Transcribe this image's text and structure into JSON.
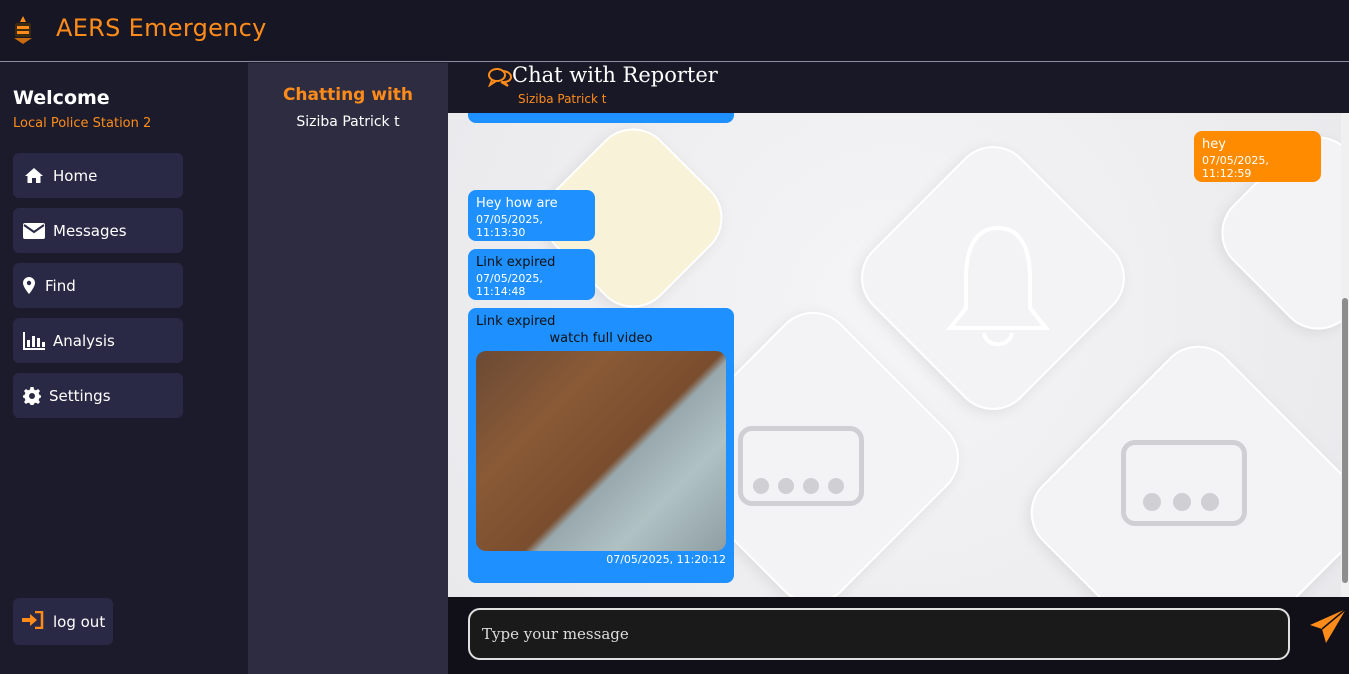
{
  "app": {
    "title": "AERS Emergency"
  },
  "sidebar": {
    "welcome": "Welcome",
    "station": "Local Police Station 2",
    "items": [
      {
        "label": "Home",
        "icon": "home-icon"
      },
      {
        "label": "Messages",
        "icon": "envelope-icon"
      },
      {
        "label": "Find",
        "icon": "map-pin-icon"
      },
      {
        "label": "Analysis",
        "icon": "bar-chart-icon"
      },
      {
        "label": "Settings",
        "icon": "gear-icon"
      }
    ],
    "logout": "log out"
  },
  "contacts": {
    "heading": "Chatting with",
    "name": "Siziba Patrick t"
  },
  "chat": {
    "title": "Chat with Reporter",
    "subtitle": "Siziba Patrick t",
    "messages": [
      {
        "dir": "out",
        "text": "hey",
        "time": "07/05/2025, 11:12:59"
      },
      {
        "dir": "in",
        "text": "Hey how are",
        "time": "07/05/2025, 11:13:30"
      },
      {
        "dir": "in",
        "text": "Link expired",
        "time": "07/05/2025, 11:14:48"
      },
      {
        "dir": "in",
        "text": "Link expired",
        "video_label": "watch full video",
        "time": "07/05/2025, 11:20:12"
      }
    ],
    "input_placeholder": "Type your message"
  },
  "colors": {
    "accent": "#ff8c1a",
    "incoming": "#1e90ff",
    "outgoing": "#ff8c00"
  }
}
